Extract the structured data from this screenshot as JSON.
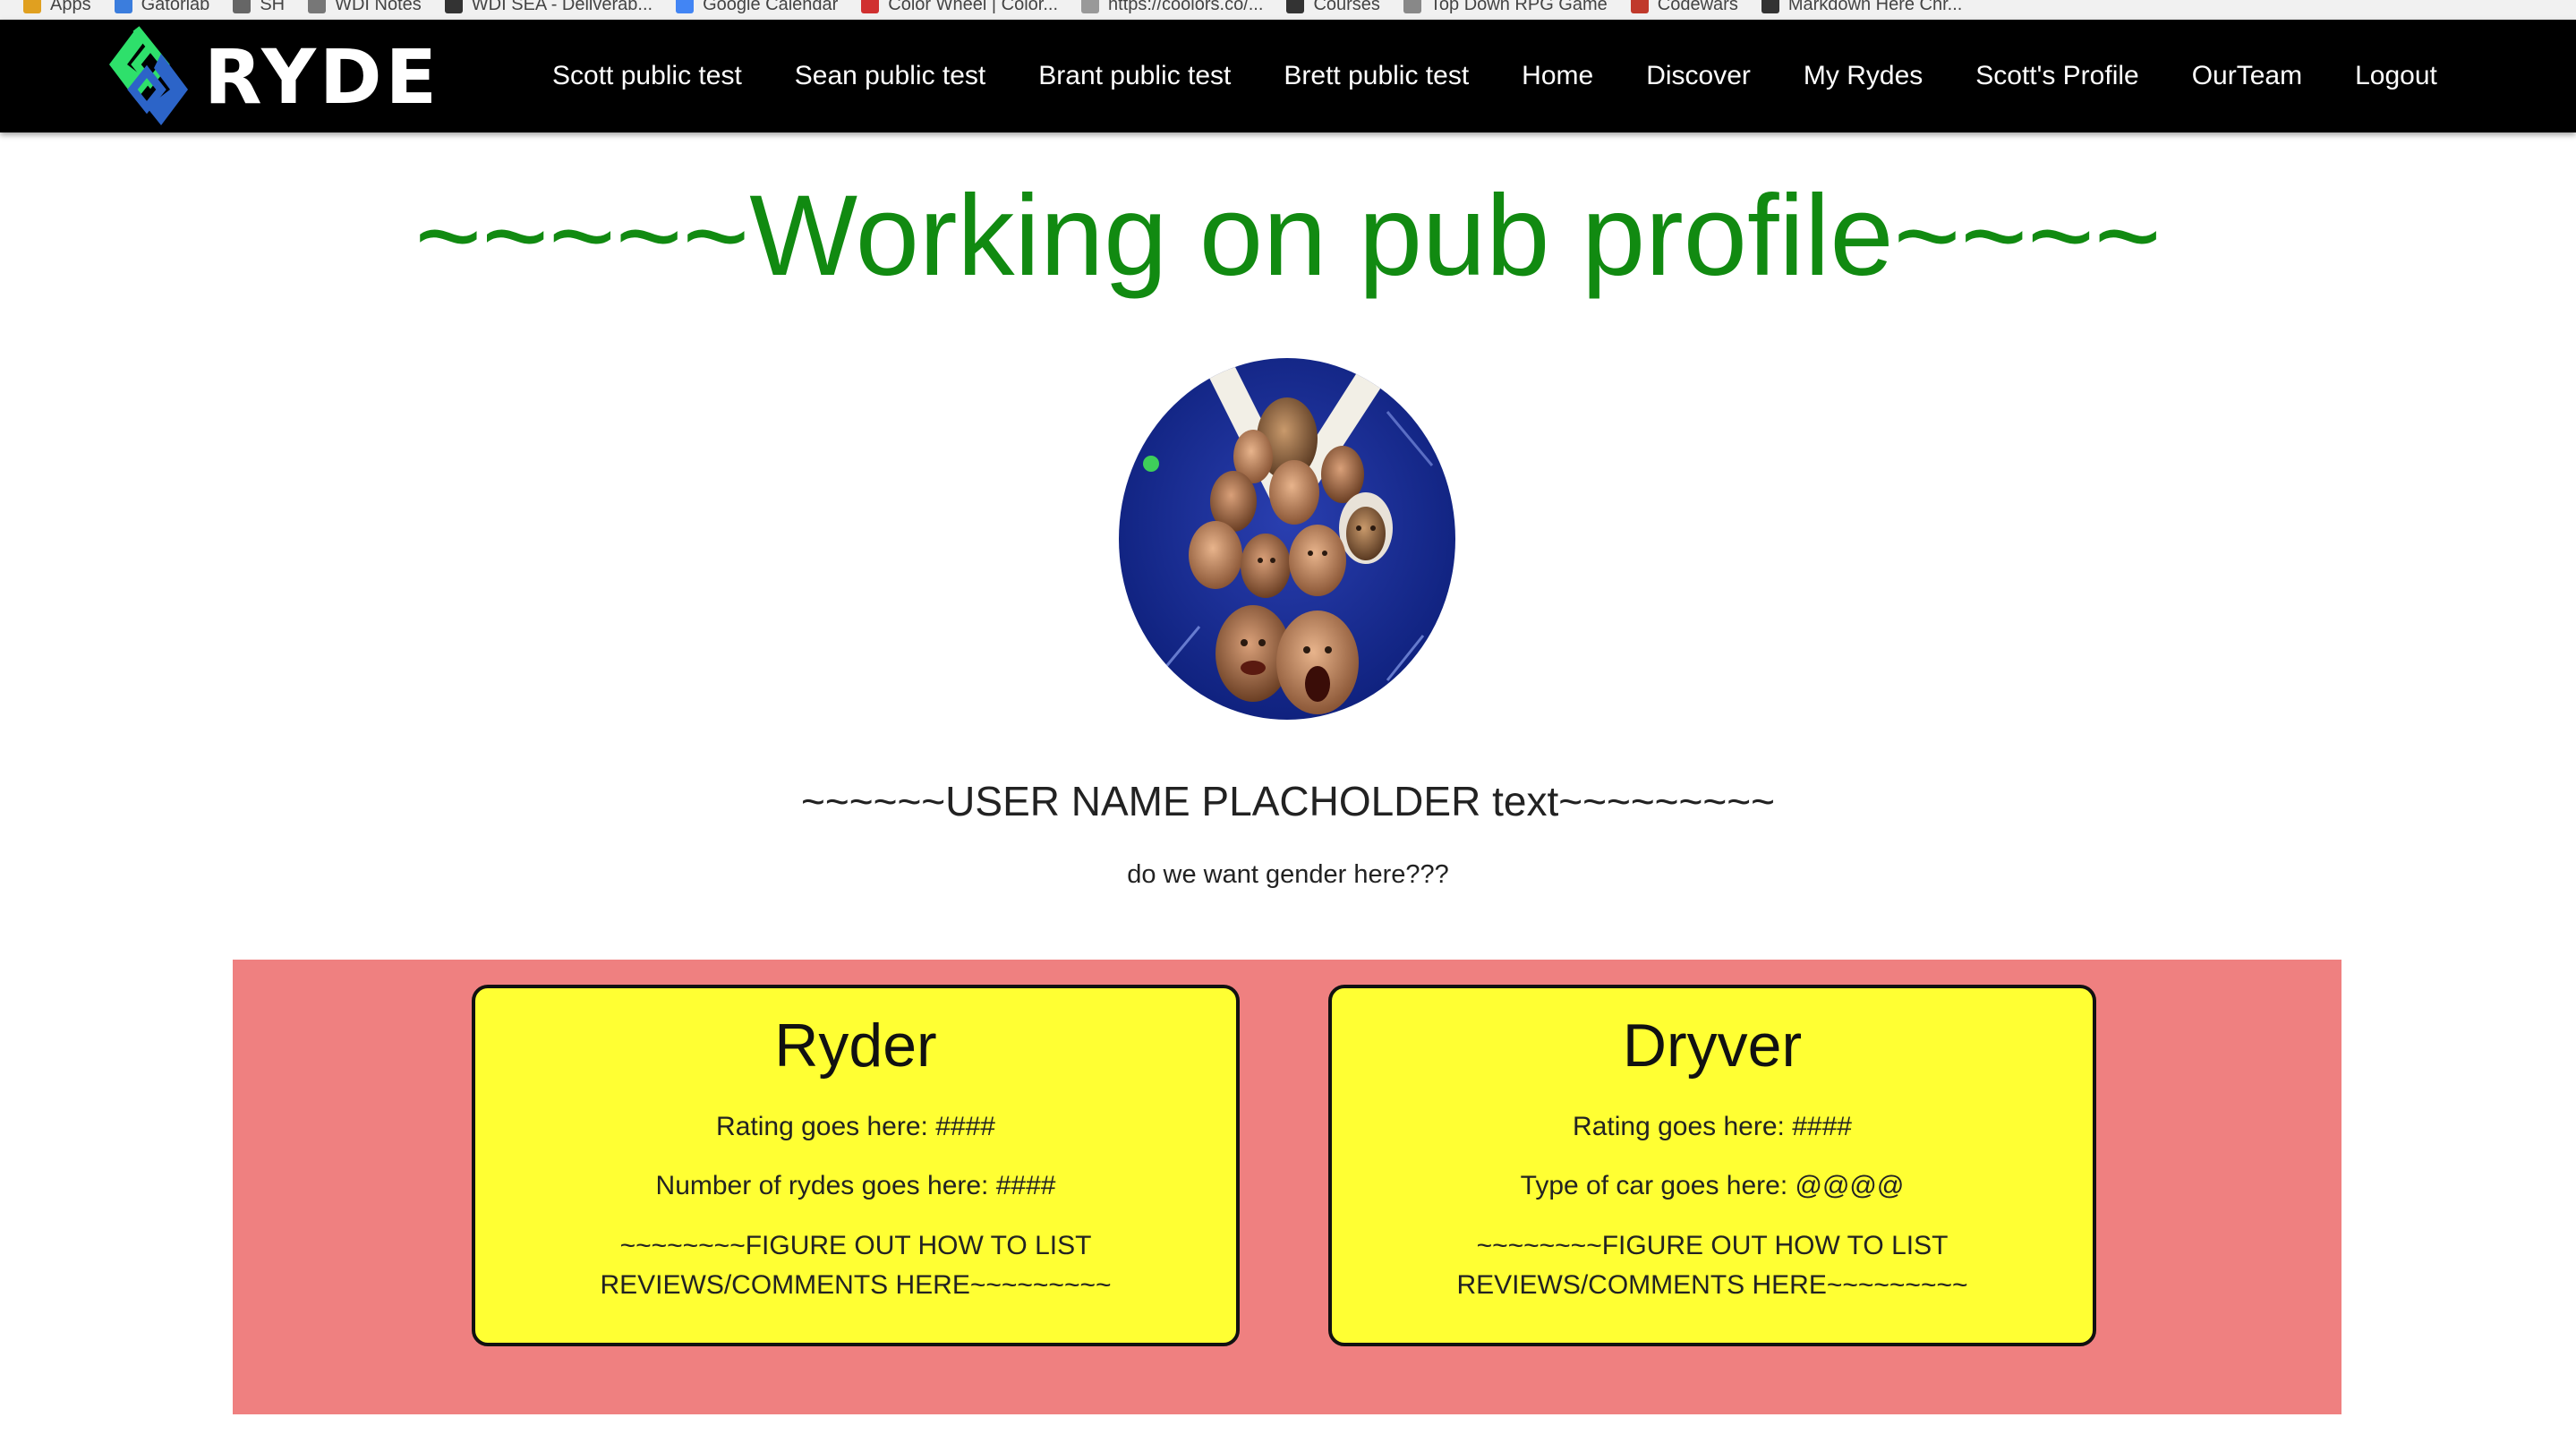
{
  "bookmarks": [
    {
      "label": "Apps",
      "color": "#e0a020"
    },
    {
      "label": "Gatorlab",
      "color": "#3b7ddd"
    },
    {
      "label": "SH",
      "color": "#666666"
    },
    {
      "label": "WDI Notes",
      "color": "#777777"
    },
    {
      "label": "WDI SEA - Deliverab...",
      "color": "#333333"
    },
    {
      "label": "Google Calendar",
      "color": "#4285f4"
    },
    {
      "label": "Color Wheel | Color...",
      "color": "#d03030"
    },
    {
      "label": "https://coolors.co/...",
      "color": "#999999"
    },
    {
      "label": "Courses",
      "color": "#333333"
    },
    {
      "label": "Top Down RPG Game",
      "color": "#888888"
    },
    {
      "label": "Codewars",
      "color": "#c0392b"
    },
    {
      "label": "Markdown Here Chr...",
      "color": "#333333"
    }
  ],
  "brand": {
    "name": "RYDE",
    "logo_colors": {
      "green": "#2ee06b",
      "blue": "#2c64c8"
    }
  },
  "nav": {
    "links": [
      {
        "label": "Scott public test"
      },
      {
        "label": "Sean public test"
      },
      {
        "label": "Brant public test"
      },
      {
        "label": "Brett public test"
      },
      {
        "label": "Home"
      },
      {
        "label": "Discover"
      },
      {
        "label": "My Rydes"
      },
      {
        "label": "Scott's Profile"
      },
      {
        "label": "OurTeam"
      },
      {
        "label": "Logout"
      }
    ]
  },
  "profile": {
    "heading": "~~~~~Working on pub profile~~~~",
    "username": "~~~~~~USER NAME PLACHOLDER text~~~~~~~~~",
    "gender_note": "do we want gender here???",
    "avatar_icon": "collage-avatar-image"
  },
  "cards": {
    "ryder": {
      "title": "Ryder",
      "line1": "Rating goes here: ####",
      "line2": "Number of rydes goes here: ####",
      "reviews": "~~~~~~~~FIGURE OUT HOW TO LIST REVIEWS/COMMENTS HERE~~~~~~~~~"
    },
    "dryver": {
      "title": "Dryver",
      "line1": "Rating goes here: ####",
      "line2": "Type of car goes here: @@@@",
      "reviews": "~~~~~~~~FIGURE OUT HOW TO LIST REVIEWS/COMMENTS HERE~~~~~~~~~"
    }
  },
  "colors": {
    "heading_green": "#118a11",
    "panel_pink": "#ef8080",
    "card_yellow": "#ffff33",
    "navbar_black": "#000000"
  }
}
